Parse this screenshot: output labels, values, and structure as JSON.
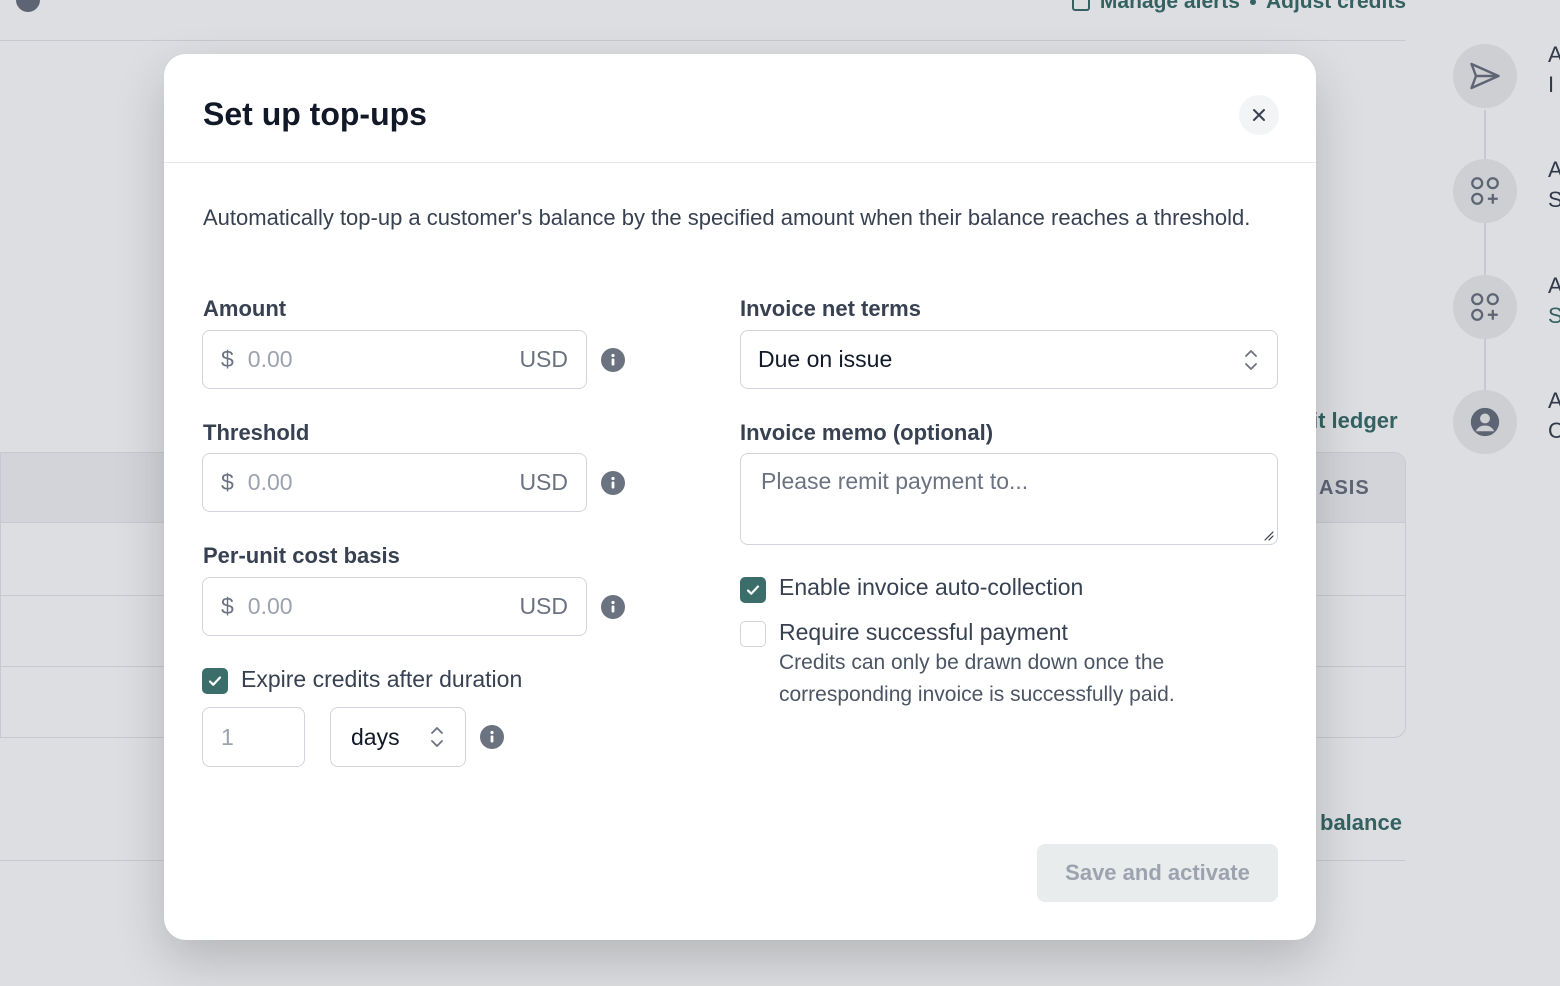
{
  "background": {
    "top_actions": {
      "manage_alerts": "Manage alerts",
      "adjust_credits": "Adjust credits"
    },
    "ledger_link": "it ledger",
    "table_header_fragment": "ASIS",
    "balance_link": "balance",
    "timeline": [
      {
        "icon": "send-icon",
        "title": "A",
        "subtitle": "I"
      },
      {
        "icon": "apps-add-icon",
        "title": "A",
        "subtitle": "S"
      },
      {
        "icon": "apps-add-icon",
        "title": "A",
        "subtitle": "S"
      },
      {
        "icon": "user-icon",
        "title": "A",
        "subtitle": "C"
      }
    ]
  },
  "modal": {
    "title": "Set up top-ups",
    "close_icon": "close-icon",
    "description": "Automatically top-up a customer's balance by the specified amount when their balance reaches a threshold.",
    "amount": {
      "label": "Amount",
      "prefix": "$",
      "placeholder": "0.00",
      "suffix": "USD"
    },
    "threshold": {
      "label": "Threshold",
      "prefix": "$",
      "placeholder": "0.00",
      "suffix": "USD"
    },
    "cost_basis": {
      "label": "Per-unit cost basis",
      "prefix": "$",
      "placeholder": "0.00",
      "suffix": "USD"
    },
    "expire": {
      "label": "Expire credits after duration",
      "checked": true,
      "duration_placeholder": "1",
      "unit": "days"
    },
    "net_terms": {
      "label": "Invoice net terms",
      "value": "Due on issue"
    },
    "memo": {
      "label": "Invoice memo (optional)",
      "placeholder": "Please remit payment to..."
    },
    "auto_collection": {
      "label": "Enable invoice auto-collection",
      "checked": true
    },
    "require_payment": {
      "label": "Require successful payment",
      "checked": false,
      "help": "Credits can only be drawn down once the corresponding invoice is successfully paid."
    },
    "save_button": "Save and activate"
  },
  "colors": {
    "accent": "#3b6e6a",
    "disabled_bg": "#e9ecec",
    "disabled_text": "#9ca3af"
  }
}
